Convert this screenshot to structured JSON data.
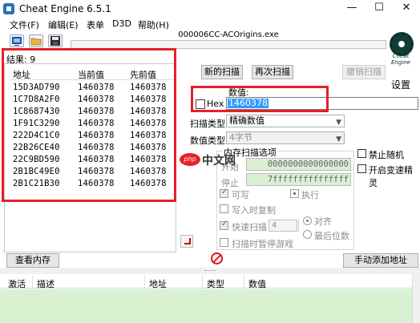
{
  "window": {
    "title": "Cheat Engine 6.5.1",
    "minimize": "—",
    "maximize": "☐",
    "close": "✕"
  },
  "menu": {
    "items": [
      "文件(F)",
      "编辑(E)",
      "表单",
      "D3D",
      "帮助(H)"
    ]
  },
  "toolbar": {
    "icons": [
      "open-process-icon",
      "open-file-icon",
      "save-icon"
    ]
  },
  "process": {
    "name": "000006CC-ACOrigins.exe"
  },
  "results": {
    "count_label": "结果: 9",
    "columns": [
      "地址",
      "当前值",
      "先前值"
    ],
    "rows": [
      [
        "15D3AD790",
        "1460378",
        "1460378"
      ],
      [
        "1C7D8A2F0",
        "1460378",
        "1460378"
      ],
      [
        "1C8687430",
        "1460378",
        "1460378"
      ],
      [
        "1F91C3290",
        "1460378",
        "1460378"
      ],
      [
        "222D4C1C0",
        "1460378",
        "1460378"
      ],
      [
        "22B26CE40",
        "1460378",
        "1460378"
      ],
      [
        "22C9BD590",
        "1460378",
        "1460378"
      ],
      [
        "2B1BC49E0",
        "1460378",
        "1460378"
      ],
      [
        "2B1C21B30",
        "1460378",
        "1460378"
      ]
    ]
  },
  "scan": {
    "new_scan": "新的扫描",
    "next_scan": "再次扫描",
    "undo_scan": "撤销扫描",
    "value_label": "数值:",
    "hex_label": "Hex",
    "value": "1460378",
    "scan_type_label": "扫描类型",
    "scan_type": "精确数值",
    "value_type_label": "数值类型",
    "value_type": "4字节"
  },
  "memory_options": {
    "title": "内存扫描选项",
    "start_label": "开始",
    "stop_label": "停止",
    "start": "0000000000000000",
    "stop": "7fffffffffffffff",
    "writable": "可写",
    "executable": "执行",
    "copy_on_write": "写入时复制",
    "fast_scan": "快速扫描",
    "fast_scan_value": "4",
    "align": "对齐",
    "last_digits": "最后位数",
    "pause_game": "扫描时暂停游戏"
  },
  "side_options": {
    "disable_random": "禁止随机",
    "speedhack": "开启变速精灵"
  },
  "settings": {
    "logo_text": "Cheat Engine",
    "label": "设置"
  },
  "bottom": {
    "view_memory": "查看内存",
    "add_address": "手动添加地址"
  },
  "address_list": {
    "columns": [
      "激活",
      "描述",
      "地址",
      "类型",
      "数值"
    ]
  },
  "overlay": {
    "logo": "php",
    "text": "中文网"
  },
  "colors": {
    "highlight": "#e4202b",
    "selection": "#3399ff",
    "readonly_green": "#d9f0d3"
  }
}
